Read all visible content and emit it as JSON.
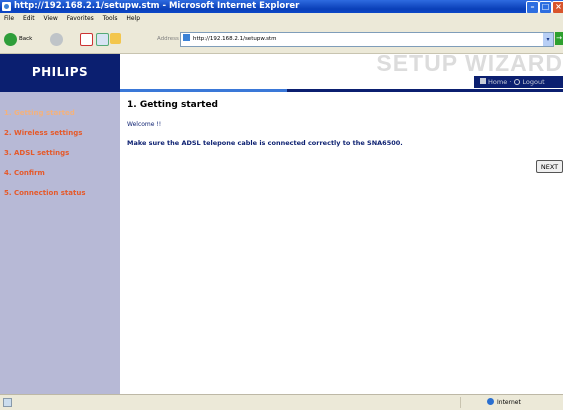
{
  "window": {
    "title": "http://192.168.2.1/setupw.stm - Microsoft Internet Explorer",
    "controls": {
      "minimize": "–",
      "maximize": "□",
      "close": "×"
    }
  },
  "menu": [
    "File",
    "Edit",
    "View",
    "Favorites",
    "Tools",
    "Help"
  ],
  "toolbar": {
    "back_label": "Back",
    "address_label": "Address",
    "address_value": "http://192.168.2.1/setupw.stm",
    "go_label": "→"
  },
  "header": {
    "logo": "PHILIPS",
    "wizard_title": "SETUP WIZARD",
    "home_label": "Home",
    "logout_label": "Logout",
    "home_separator": "·"
  },
  "sidebar": {
    "items": [
      {
        "label": "1. Getting started",
        "active": true
      },
      {
        "label": "2. Wireless settings",
        "active": false
      },
      {
        "label": "3. ADSL settings",
        "active": false
      },
      {
        "label": "4. Confirm",
        "active": false
      },
      {
        "label": "5. Connection status",
        "active": false
      }
    ]
  },
  "main": {
    "title": "1. Getting started",
    "welcome": "Welcome !!",
    "instruction": "Make sure the ADSL telepone cable is connected correctly to the SNA6500.",
    "next_button": "NEXT"
  },
  "status": {
    "zone": "Internet"
  },
  "colors": {
    "navy": "#0b1f70",
    "sidebar_bg": "#b7b9d6",
    "sidebar_text": "#e55a2b",
    "accent_blue": "#3a78d8"
  }
}
